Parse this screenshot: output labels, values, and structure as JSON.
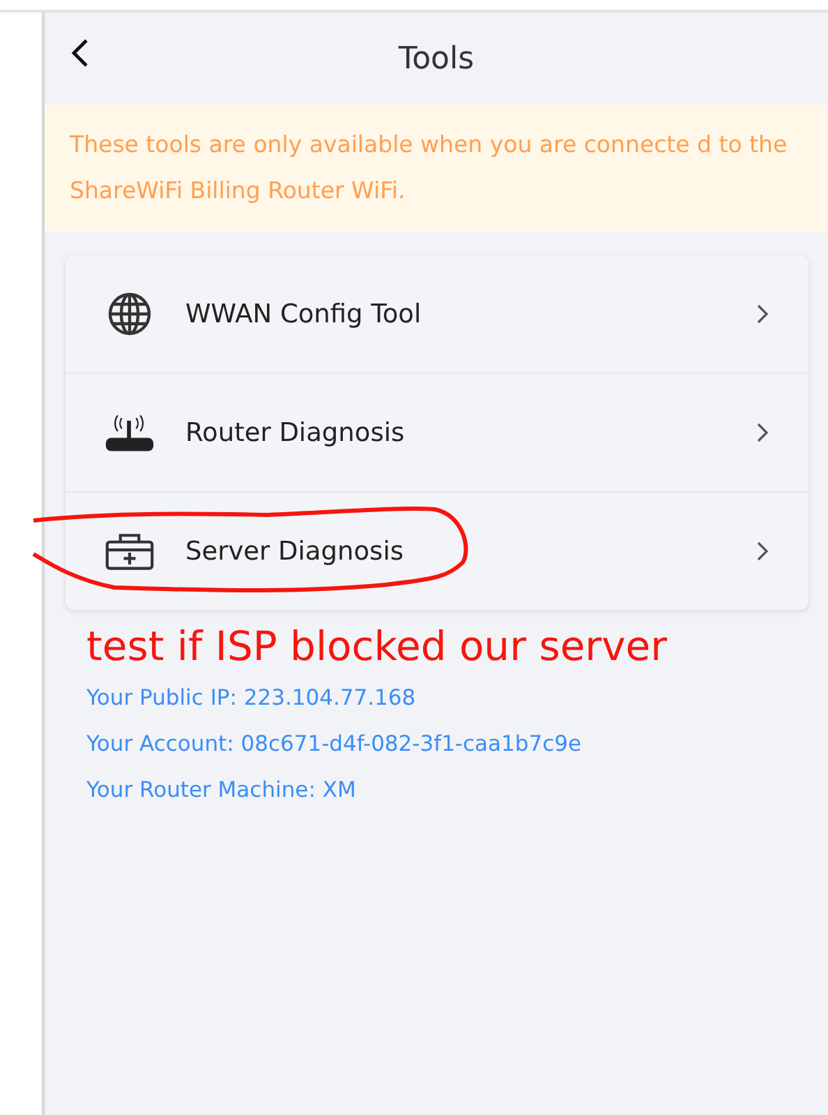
{
  "header": {
    "title": "Tools"
  },
  "notice": "These tools are only available when you are connecte d to the ShareWiFi Billing Router WiFi.",
  "tools": [
    {
      "kind": "globe",
      "label": "WWAN Config Tool",
      "highlighted": false
    },
    {
      "kind": "router",
      "label": "Router Diagnosis",
      "highlighted": false
    },
    {
      "kind": "toolbox",
      "label": "Server Diagnosis",
      "highlighted": true
    }
  ],
  "annotation": "test if ISP blocked our server",
  "info": [
    "Your Public IP: 223.104.77.168",
    "Your Account: 08c671-d4f-082-3f1-caa1b7c9e",
    "Your Router Machine: XM"
  ]
}
